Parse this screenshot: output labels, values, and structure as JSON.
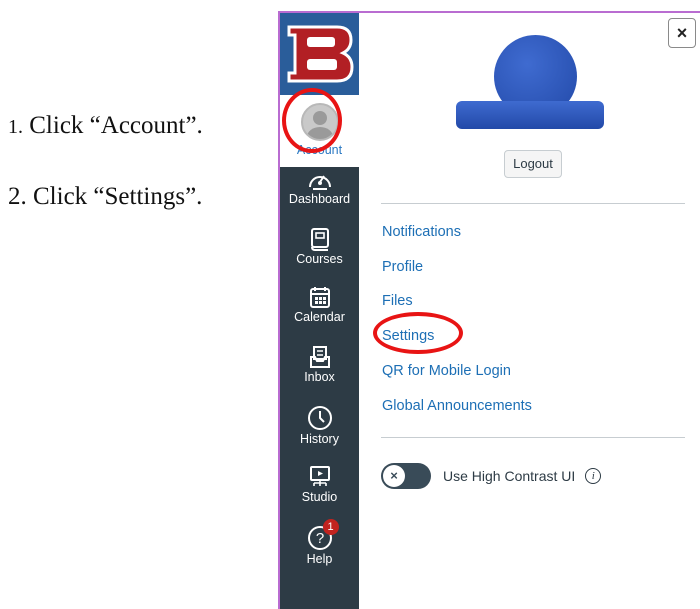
{
  "instructions": {
    "step1_num": "1.",
    "step1_text": "Click “Account”.",
    "step2_num": "2.",
    "step2_text": "Click “Settings”."
  },
  "global_nav": {
    "logo_letter": "B",
    "items": [
      {
        "label": "Account",
        "icon": "user-avatar-icon"
      },
      {
        "label": "Dashboard",
        "icon": "speedometer-icon"
      },
      {
        "label": "Courses",
        "icon": "book-icon"
      },
      {
        "label": "Calendar",
        "icon": "calendar-icon"
      },
      {
        "label": "Inbox",
        "icon": "inbox-icon"
      },
      {
        "label": "History",
        "icon": "clock-icon"
      },
      {
        "label": "Studio",
        "icon": "studio-icon"
      },
      {
        "label": "Help",
        "icon": "help-icon",
        "badge": "1"
      }
    ]
  },
  "tray": {
    "close_icon": "×",
    "logout_label": "Logout",
    "links": [
      "Notifications",
      "Profile",
      "Files",
      "Settings",
      "QR for Mobile Login",
      "Global Announcements"
    ],
    "high_contrast_label": "Use High Contrast UI",
    "info_icon_glyph": "i",
    "toggle_glyph": "×"
  },
  "colors": {
    "nav_bg": "#2d3b45",
    "logo_bg": "#2a5d9a",
    "link": "#1d6fb5",
    "annotation": "#e81414",
    "avatar_blue": "#2249a8"
  }
}
